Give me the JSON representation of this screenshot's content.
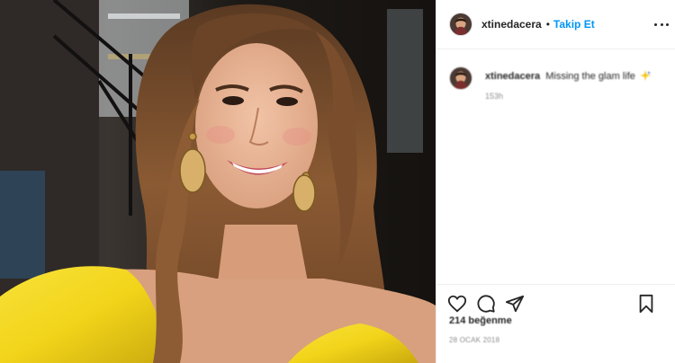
{
  "header": {
    "username": "xtinedacera",
    "separator": "•",
    "follow_label": "Takip Et",
    "more_icon": "more-horizontal-icon"
  },
  "caption": {
    "username": "xtinedacera",
    "text": "Missing the glam life",
    "emoji_icon": "sparkle-emoji-icon",
    "time": "153h"
  },
  "actions": {
    "like_icon": "heart-icon",
    "comment_icon": "comment-icon",
    "share_icon": "share-icon",
    "save_icon": "bookmark-icon"
  },
  "likes_text": "214 beğenme",
  "date_text": "28 OCAK 2018",
  "colors": {
    "follow_blue": "#0095f6",
    "dress_yellow": "#f2d41a",
    "hair_brown": "#8a5a33"
  }
}
